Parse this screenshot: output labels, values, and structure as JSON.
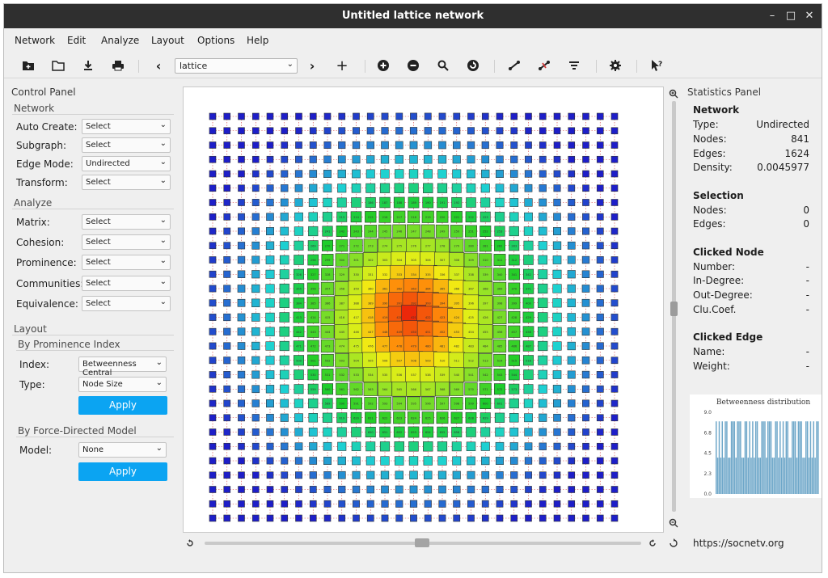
{
  "window": {
    "title": "Untitled lattice network"
  },
  "menu": [
    "Network",
    "Edit",
    "Analyze",
    "Layout",
    "Options",
    "Help"
  ],
  "toolbar": {
    "network_select": "lattice",
    "prev": "‹",
    "next": "›",
    "add": "+"
  },
  "control_panel": {
    "title": "Control Panel",
    "network_section": "Network",
    "network_rows": [
      {
        "label": "Auto Create:",
        "value": "Select"
      },
      {
        "label": "Subgraph:",
        "value": "Select"
      },
      {
        "label": "Edge Mode:",
        "value": "Undirected"
      },
      {
        "label": "Transform:",
        "value": "Select"
      }
    ],
    "analyze_section": "Analyze",
    "analyze_rows": [
      {
        "label": "Matrix:",
        "value": "Select"
      },
      {
        "label": "Cohesion:",
        "value": "Select"
      },
      {
        "label": "Prominence:",
        "value": "Select"
      },
      {
        "label": "Communities:",
        "value": "Select"
      },
      {
        "label": "Equivalence:",
        "value": "Select"
      }
    ],
    "layout_section": "Layout",
    "prominence_section": "By Prominence Index",
    "index_label": "Index:",
    "index_value": "Betweenness Central",
    "type_label": "Type:",
    "type_value": "Node Size",
    "apply_label": "Apply",
    "force_section": "By Force-Directed Model",
    "model_label": "Model:",
    "model_value": "None",
    "apply2_label": "Apply"
  },
  "stats_panel": {
    "title": "Statistics Panel",
    "network": {
      "heading": "Network",
      "type_label": "Type:",
      "type_value": "Undirected",
      "nodes_label": "Nodes:",
      "nodes_value": "841",
      "edges_label": "Edges:",
      "edges_value": "1624",
      "density_label": "Density:",
      "density_value": "0.0045977"
    },
    "selection": {
      "heading": "Selection",
      "nodes_label": "Nodes:",
      "nodes_value": "0",
      "edges_label": "Edges:",
      "edges_value": "0"
    },
    "clicked_node": {
      "heading": "Clicked Node",
      "number_label": "Number:",
      "number_value": "-",
      "indeg_label": "In-Degree:",
      "indeg_value": "-",
      "outdeg_label": "Out-Degree:",
      "outdeg_value": "-",
      "clucoef_label": "Clu.Coef.",
      "clucoef_value": "-"
    },
    "clicked_edge": {
      "heading": "Clicked Edge",
      "name_label": "Name:",
      "name_value": "-",
      "weight_label": "Weight:",
      "weight_value": "-"
    },
    "histogram": {
      "title": "Betweenness distribution",
      "y_ticks": [
        "9.0",
        "6.8",
        "4.5",
        "2.3",
        "0.0"
      ],
      "ymax": 9.0
    },
    "url": "https://socnetv.org"
  },
  "lattice": {
    "grid_size": 29,
    "colors": {
      "edge": "#d23b3b",
      "node_border": "#333333"
    }
  }
}
